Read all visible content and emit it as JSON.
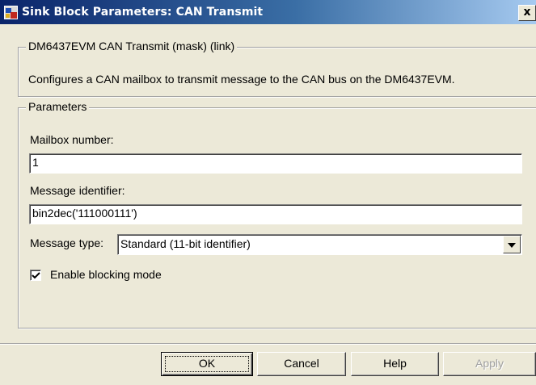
{
  "window": {
    "title": "Sink Block Parameters: CAN Transmit",
    "close_glyph": "x"
  },
  "description_group": {
    "legend": "DM6437EVM CAN Transmit (mask) (link)",
    "text": "Configures a CAN mailbox to transmit message to the CAN bus on the DM6437EVM."
  },
  "parameters": {
    "legend": "Parameters",
    "mailbox_label": "Mailbox number:",
    "mailbox_value": "1",
    "msgid_label": "Message identifier:",
    "msgid_value": "bin2dec('111000111')",
    "msgtype_label": "Message type:",
    "msgtype_value": "Standard (11-bit identifier)",
    "blocking_label": "Enable blocking mode",
    "blocking_checked": true
  },
  "buttons": {
    "ok": "OK",
    "cancel": "Cancel",
    "help": "Help",
    "apply": "Apply"
  },
  "colors": {
    "dialog_bg": "#ece9d8",
    "titlebar_start": "#0a246a",
    "titlebar_end": "#a6caf0",
    "disabled_text": "#a0a0a0"
  },
  "icons": {
    "app": "simulink-block-icon",
    "close": "close-icon",
    "dropdown": "chevron-down-icon",
    "checkbox": "checkmark-icon"
  }
}
